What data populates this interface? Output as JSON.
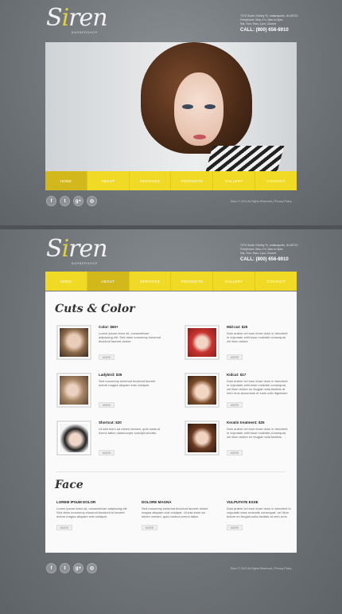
{
  "brand": {
    "name_pre": "S",
    "name_accent": "i",
    "name_post": "ren",
    "tagline": "BARBERSHOP"
  },
  "contact": {
    "line1": "7270 South Shelby St, Indianapolis, IN 46713",
    "line2": "Freephone: Mon–Fri, 9am to 5pm",
    "line3": "Sat, Sun: 9am–1pm; Closed",
    "call": "CALL: (800) 656-8910"
  },
  "nav": [
    "HOME",
    "ABOUT",
    "SERVICES",
    "PRODUCTS",
    "GALLERY",
    "CONTACT"
  ],
  "social": [
    "f",
    "t",
    "g+",
    "◎"
  ],
  "footer": {
    "copyright": "Siren © 2012 All Rights Reserved  |  Privacy Policy"
  },
  "cuts": {
    "heading": "Cuts & Color",
    "items": [
      {
        "title": "Color: $60+",
        "text": "Lorem ipsum dolor sit, consectetuer adipiscing elit. Sed diam nonummy eiusmod tincidunt laoreet dolore",
        "more": "MORE"
      },
      {
        "title": "Mid-cut: $25",
        "text": "Duis autem vel eum iriure dolor in hendrerit in vulputate velit esse molestie consequat vel illum dolore",
        "more": "MORE"
      },
      {
        "title": "Ladybird: $35",
        "text": "Sed nonummy euismod tincidunt laoreet dolore magna aliquam erat volutpat.",
        "more": "MORE"
      },
      {
        "title": "Kidcut: $17",
        "text": "Duis autem vel eum iriure dolor in hendrerit in vulputate velit esse molestie consequat, vel illum dolore eu feugiat nulla facilisis at vero eros accumsan et iusto odio dignissim",
        "more": "MORE"
      },
      {
        "title": "Shortcut: $20",
        "text": "Ut wisi enim ad minim veniam, quis nostrud exerci tation ullamcorper suscipit lobortis.",
        "more": "MORE"
      },
      {
        "title": "Keratin treatment: $25",
        "text": "Duis autem vel eum iriure dolor in hendrerit in vulputate velit esse molestie consequat, vel illum dolore eu feugiat nulla facilisis.",
        "more": "MORE"
      }
    ]
  },
  "face": {
    "heading": "Face",
    "cols": [
      {
        "title": "LOREM IPSUM DOLOR",
        "text": "Lorem ipsum dolor sit, consectetuer adipiscing elit. Sed diam nonummy eiusmod tincidunt ut laoreet dolore magna aliquam erat volutpat.",
        "more": "MORE"
      },
      {
        "title": "DOLORE MAGNA",
        "text": "Sed nonummy euismod tincidunt laoreet dolore magna aliquam erat volutpat. Ut wisi enim ad minim veniam, quis nostrud exerci tation.",
        "more": "MORE"
      },
      {
        "title": "VULPUTATE ESSE",
        "text": "Duis autem vel eum iriure dolor in hendrerit in vulputate esse molestie consequat, vel illum dolore eu feugiat nulla facilisis at vero eros.",
        "more": "MORE"
      }
    ]
  },
  "colors": {
    "accent": "#f1da26",
    "accent_dark": "#d2b81a",
    "bg": "#6f7479"
  }
}
